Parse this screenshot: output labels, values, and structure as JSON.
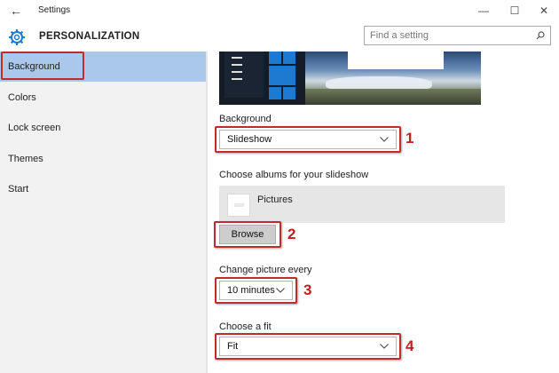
{
  "window": {
    "title": "Settings",
    "back_icon": "arrow-left-icon",
    "controls": {
      "minimize": "—",
      "maximize": "☐",
      "close": "✕"
    }
  },
  "header": {
    "title": "PERSONALIZATION",
    "icon": "gear-icon",
    "search_placeholder": "Find a setting"
  },
  "sidebar": {
    "items": [
      {
        "label": "Background",
        "active": true
      },
      {
        "label": "Colors"
      },
      {
        "label": "Lock screen"
      },
      {
        "label": "Themes"
      },
      {
        "label": "Start"
      }
    ]
  },
  "main": {
    "background": {
      "label": "Background",
      "value": "Slideshow"
    },
    "albums": {
      "label": "Choose albums for your slideshow",
      "album_name": "Pictures",
      "browse_label": "Browse"
    },
    "interval": {
      "label": "Change picture every",
      "value": "10 minutes"
    },
    "fit": {
      "label": "Choose a fit",
      "value": "Fit"
    }
  },
  "annotations": {
    "n1": "1",
    "n2": "2",
    "n3": "3",
    "n4": "4",
    "color": "#c02b2b"
  },
  "colors": {
    "sidebar_active": "#a9c8ea",
    "accent_tile": "#1e7ad1"
  }
}
